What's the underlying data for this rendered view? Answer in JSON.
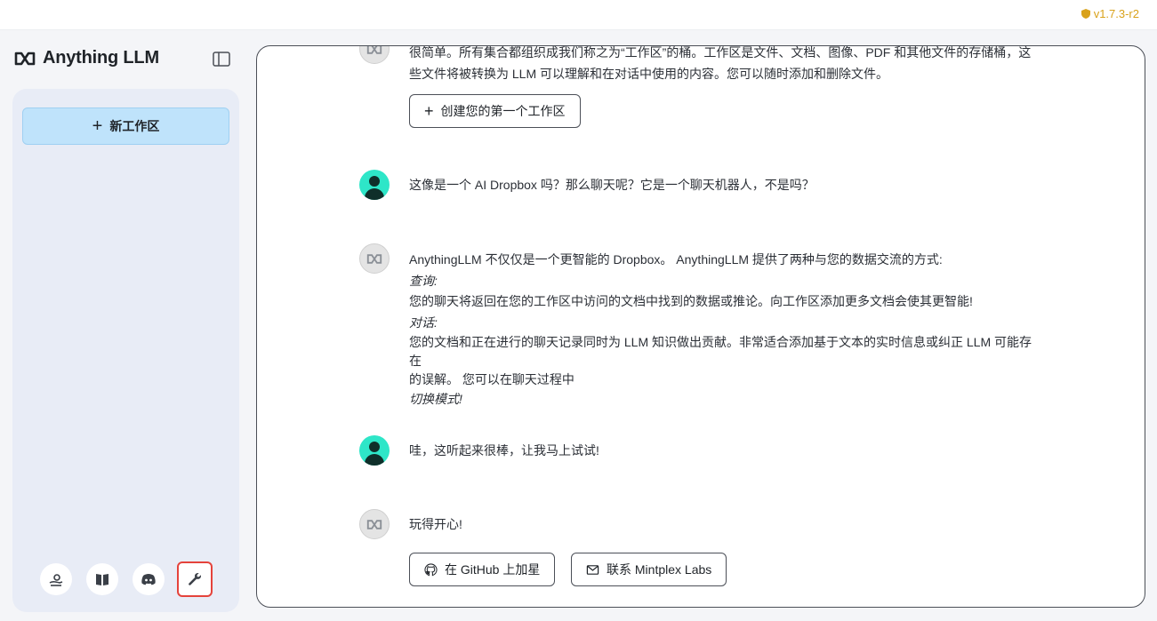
{
  "version": "v1.7.3-r2",
  "brand": {
    "name": "Anything LLM"
  },
  "sidebar": {
    "new_workspace_label": "新工作区",
    "footer_icons": [
      "community-hub-icon",
      "docs-book-icon",
      "discord-icon",
      "settings-wrench-icon"
    ]
  },
  "chat": {
    "m1": {
      "lines": [
        "很简单。所有集合都组织成我们称之为“工作区”的桶。工作区是文件、文档、图像、PDF 和其他文件的存储桶，这",
        "些文件将被转换为 LLM 可以理解和在对话中使用的内容。您可以随时添加和删除文件。"
      ],
      "button": "创建您的第一个工作区"
    },
    "m2": {
      "text": "这像是一个 AI Dropbox 吗？那么聊天呢？它是一个聊天机器人，不是吗？"
    },
    "m3": {
      "line1": "AnythingLLM 不仅仅是一个更智能的 Dropbox。 AnythingLLM 提供了两种与您的数据交流的方式:",
      "query_label": "查询:",
      "query_text": "您的聊天将返回在您的工作区中访问的文档中找到的数据或推论。向工作区添加更多文档会使其更智能!",
      "chat_label": "对话:",
      "chat_text_1": "您的文档和正在进行的聊天记录同时为 LLM 知识做出贡献。非常适合添加基于文本的实时信息或纠正 LLM 可能存在",
      "chat_text_2": "的误解。 您可以在聊天过程中",
      "switch_mode": "切换模式!"
    },
    "m4": {
      "text": "哇，这听起来很棒，让我马上试试!"
    },
    "m5": {
      "text": "玩得开心!",
      "github_button": "在 GitHub 上加星",
      "contact_button": "联系 Mintplex Labs"
    }
  },
  "colors": {
    "accent": "#bfe3fb",
    "version": "#d9a21b",
    "user_avatar": "#2ee6c8",
    "highlight": "#e5433b"
  }
}
